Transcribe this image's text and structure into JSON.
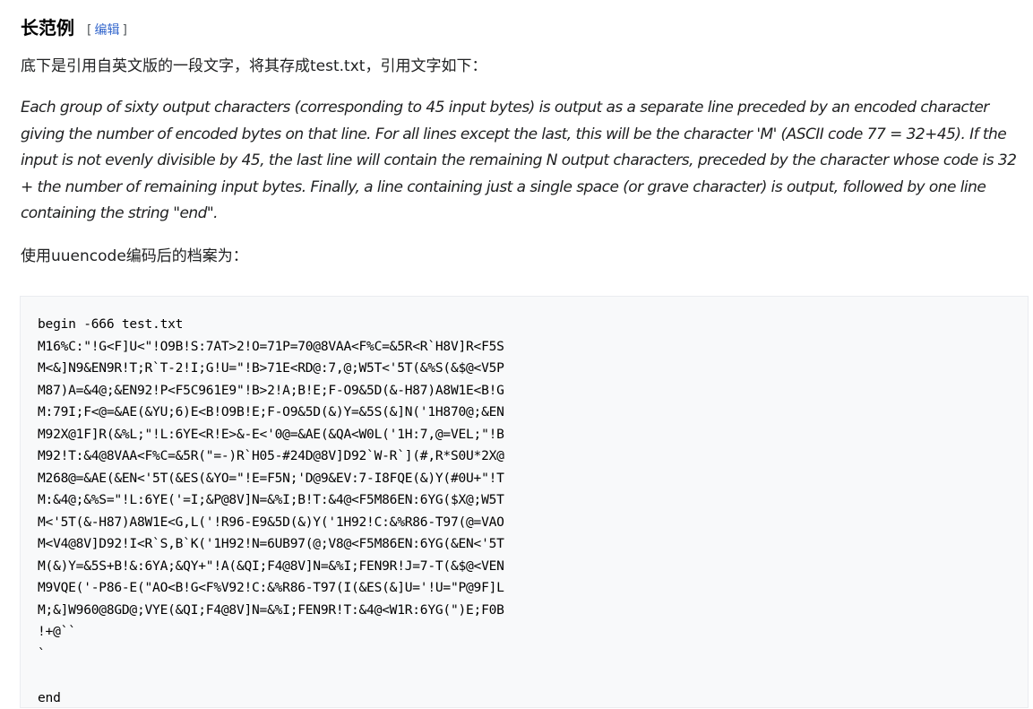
{
  "section": {
    "title": "长范例",
    "edit_open": "[",
    "edit_label": "编辑",
    "edit_close": "]"
  },
  "intro_text": "底下是引用自英文版的一段文字，将其存成test.txt，引用文字如下：",
  "quote_text": "Each group of sixty output characters (corresponding to 45 input bytes) is output as a separate line preceded by an encoded character giving the number of encoded bytes on that line. For all lines except the last, this will be the character 'M' (ASCII code 77 = 32+45). If the input is not evenly divisible by 45, the last line will contain the remaining N output characters, preceded by the character whose code is 32 + the number of remaining input bytes. Finally, a line containing just a single space (or grave character) is output, followed by one line containing the string \"end\".",
  "after_text": "使用uuencode编码后的档案为：",
  "code_block": "begin -666 test.txt\nM16%C:\"!G<F]U<\"!O9B!S:7AT>2!O=71P=70@8VAA<F%C=&5R<R`H8V]R<F5S\nM<&]N9&EN9R!T;R`T-2!I;G!U=\"!B>71E<RD@:7,@;W5T<'5T(&%S(&$@<V5P\nM87)A=&4@;&EN92!P<F5C961E9\"!B>2!A;B!E;F-O9&5D(&-H87)A8W1E<B!G\nM:79I;F<@=&AE(&YU;6)E<B!O9B!E;F-O9&5D(&)Y=&5S(&]N('1H870@;&EN\nM92X@1F]R(&%L;\"!L:6YE<R!E>&-E<'0@=&AE(&QA<W0L('1H:7,@=VEL;\"!B\nM92!T:&4@8VAA<F%C=&5R(\"=-)R`H05-#24D@8V]D92`W-R`](#,R*S0U*2X@\nM268@=&AE(&EN<'5T(&ES(&YO=\"!E=F5N;'D@9&EV:7-I8FQE(&)Y(#0U+\"!T\nM:&4@;&%S=\"!L:6YE('=I;&P@8V]N=&%I;B!T:&4@<F5M86EN:6YG($X@;W5T\nM<'5T(&-H87)A8W1E<G,L('!R96-E9&5D(&)Y('1H92!C:&%R86-T97(@=VAO\nM<V4@8V]D92!I<R`S,B`K('1H92!N=6UB97(@;V8@<F5M86EN:6YG(&EN<'5T\nM(&)Y=&5S+B!&:6YA;&QY+\"!A(&QI;F4@8V]N=&%I;FEN9R!J=7-T(&$@<VEN\nM9VQE('-P86-E(\"AO<B!G<F%V92!C:&%R86-T97(I(&ES(&]U='!U=\"P@9F]L\nM;&]W960@8GD@;VYE(&QI;F4@8V]N=&%I;FEN9R!T:&4@<W1R:6YG(\")E;F0B\n!+@``\n`\n\nend"
}
